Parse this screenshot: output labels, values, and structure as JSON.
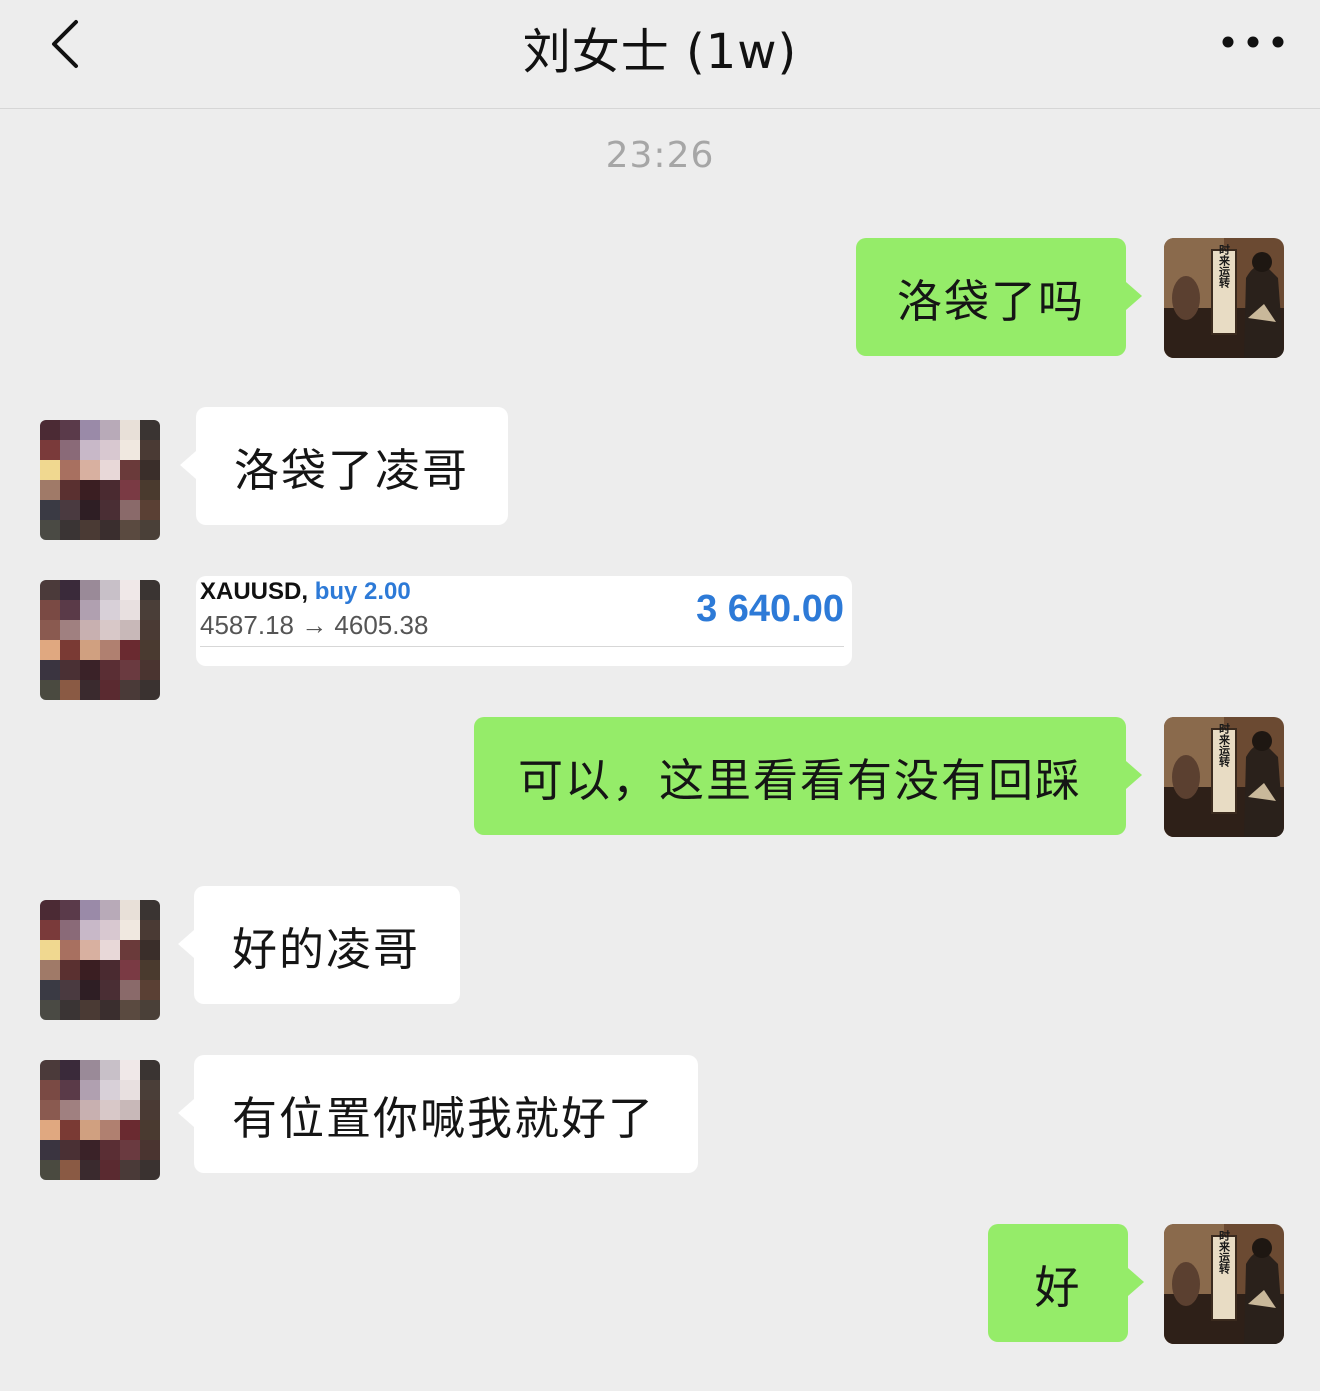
{
  "header": {
    "title": "刘女士 (1w)"
  },
  "timestamp": "23:26",
  "messages": [
    {
      "sender": "me",
      "text": "洛袋了吗"
    },
    {
      "sender": "them",
      "text": "洛袋了凌哥"
    },
    {
      "sender": "them",
      "type": "trade",
      "symbol": "XAUUSD,",
      "side": "buy 2.00",
      "prices": "4587.18 → 4605.38",
      "profit": "3 640.00"
    },
    {
      "sender": "me",
      "text": "可以，这里看看有没有回踩"
    },
    {
      "sender": "them",
      "text": "好的凌哥"
    },
    {
      "sender": "them",
      "text": "有位置你喊我就好了"
    },
    {
      "sender": "me",
      "text": "好"
    }
  ],
  "avatar_text": "时来运转",
  "colors": {
    "my_bubble": "#95ec69",
    "their_bubble": "#ffffff",
    "background": "#ededed",
    "profit_blue": "#2d7ad7"
  },
  "icons": {
    "back": "chevron-left-icon",
    "more": "more-dots-icon"
  }
}
